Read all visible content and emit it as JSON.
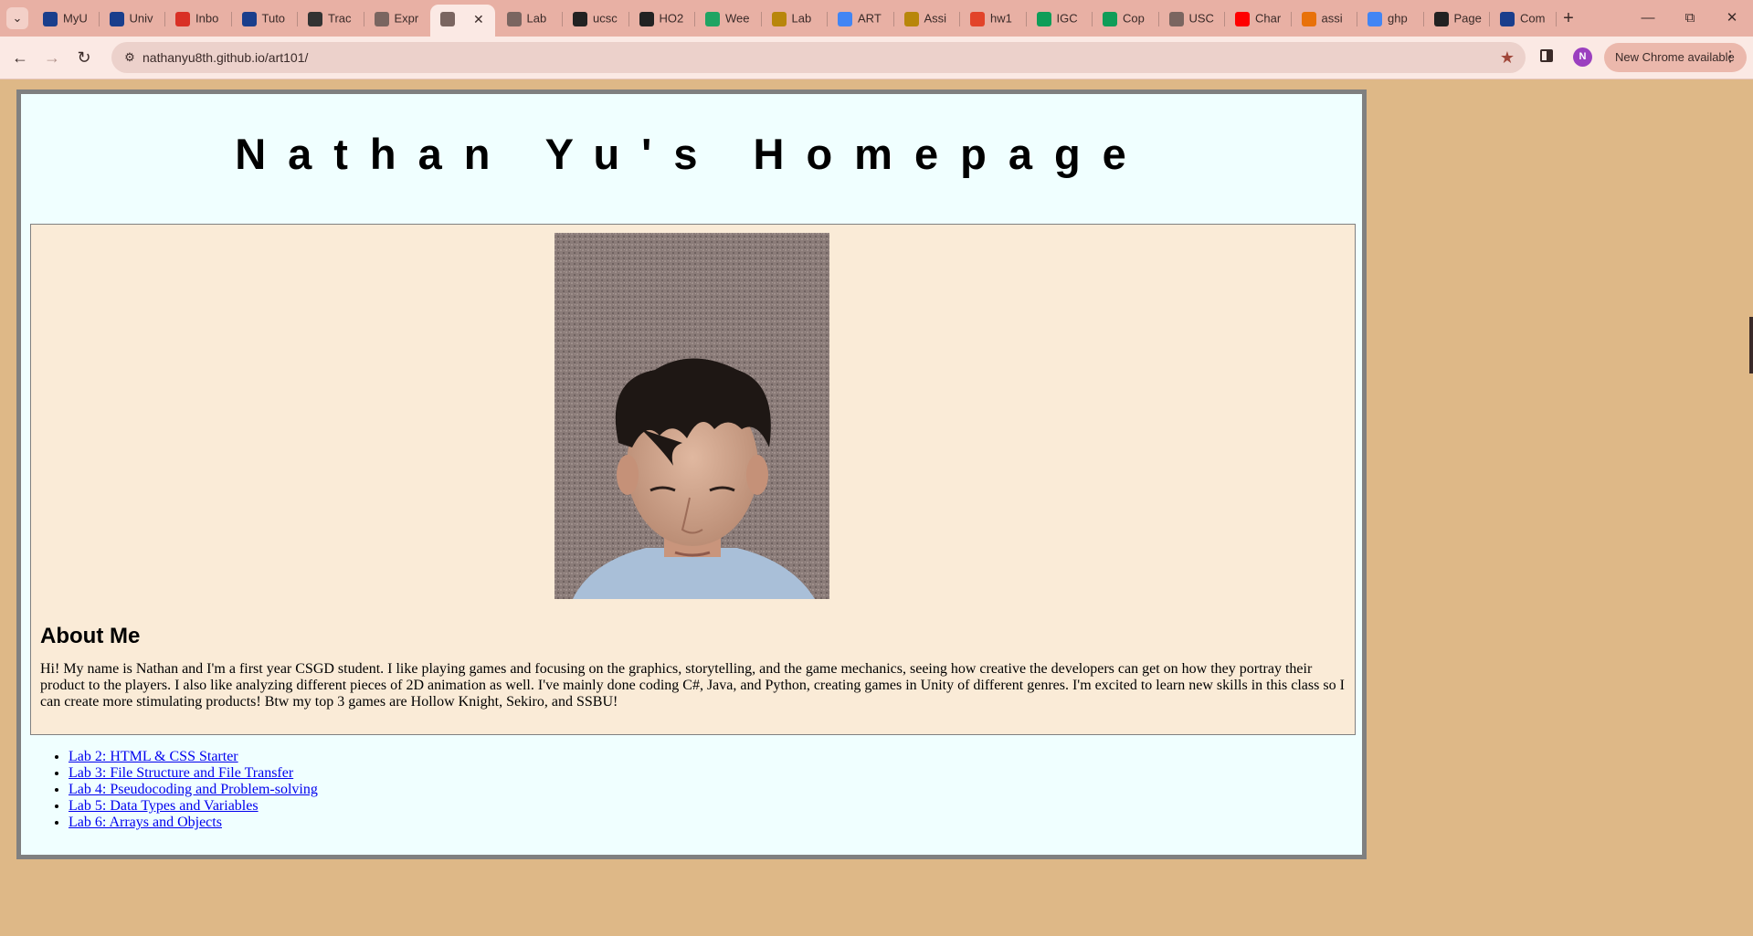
{
  "browser": {
    "tabs": [
      {
        "title": "MyU",
        "icon": "usc-icon",
        "color": "#1a3e8c"
      },
      {
        "title": "Univ",
        "icon": "usc-icon",
        "color": "#1a3e8c"
      },
      {
        "title": "Inbo",
        "icon": "gmail-icon",
        "color": "#d93025"
      },
      {
        "title": "Tuto",
        "icon": "usc-icon",
        "color": "#1a3e8c"
      },
      {
        "title": "Trac",
        "icon": "tracker-icon",
        "color": "#333333"
      },
      {
        "title": "Expr",
        "icon": "globe-icon",
        "color": "#7a6560"
      },
      {
        "title": "",
        "icon": "globe-icon",
        "color": "#7a6560",
        "active": true
      },
      {
        "title": "Lab",
        "icon": "globe-icon",
        "color": "#7a6560"
      },
      {
        "title": "ucsc",
        "icon": "github-icon",
        "color": "#222222"
      },
      {
        "title": "HO2",
        "icon": "github-icon",
        "color": "#222222"
      },
      {
        "title": "Wee",
        "icon": "drive-icon",
        "color": "#1fa463"
      },
      {
        "title": "Lab",
        "icon": "usc-icon",
        "color": "#b8860b"
      },
      {
        "title": "ART",
        "icon": "docs-icon",
        "color": "#4285f4"
      },
      {
        "title": "Assi",
        "icon": "usc-icon",
        "color": "#b8860b"
      },
      {
        "title": "hw1",
        "icon": "gitlab-icon",
        "color": "#e24329"
      },
      {
        "title": "IGC",
        "icon": "sheets-icon",
        "color": "#0f9d58"
      },
      {
        "title": "Cop",
        "icon": "sheets-icon",
        "color": "#0f9d58"
      },
      {
        "title": "USC",
        "icon": "globe-icon",
        "color": "#7a6560"
      },
      {
        "title": "Char",
        "icon": "youtube-icon",
        "color": "#ff0000"
      },
      {
        "title": "assi",
        "icon": "loading-icon",
        "color": "#e8710a"
      },
      {
        "title": "ghp",
        "icon": "google-icon",
        "color": "#4285f4"
      },
      {
        "title": "Page",
        "icon": "github-icon",
        "color": "#222222"
      },
      {
        "title": "Com",
        "icon": "usc-icon",
        "color": "#1a3e8c"
      }
    ],
    "url": "nathanyu8th.github.io/art101/",
    "profile_initial": "N",
    "update_label": "New Chrome available"
  },
  "page": {
    "title": "Nathan Yu's Homepage",
    "about_heading": "About Me",
    "about_text": "Hi! My name is Nathan and I'm a first year CSGD student. I like playing games and focusing on the graphics, storytelling, and the game mechanics, seeing how creative the developers can get on how they portray their product to the players. I also like analyzing different pieces of 2D animation as well. I've mainly done coding C#, Java, and Python, creating games in Unity of different genres. I'm excited to learn new skills in this class so I can create more stimulating products! Btw my top 3 games are Hollow Knight, Sekiro, and SSBU!",
    "labs": [
      "Lab 2: HTML & CSS Starter",
      "Lab 3: File Structure and File Transfer",
      "Lab 4: Pseudocoding and Problem-solving",
      "Lab 5: Data Types and Variables",
      "Lab 6: Arrays and Objects"
    ]
  },
  "colors": {
    "page_bg": "#deb887",
    "frame_bg": "#f0ffff",
    "about_bg": "#faebd7",
    "link": "#0000ee"
  }
}
